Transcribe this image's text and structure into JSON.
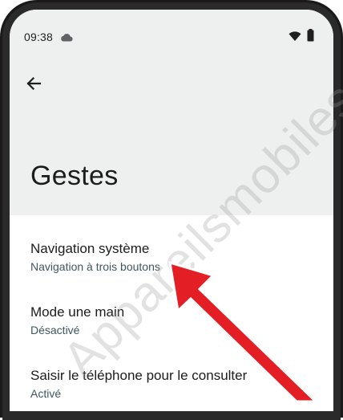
{
  "status_bar": {
    "time": "09:38",
    "icons": [
      "cloud-icon",
      "wifi-icon",
      "battery-icon"
    ]
  },
  "header": {
    "back_icon": "arrow-left-icon",
    "title": "Gestes"
  },
  "settings": [
    {
      "title": "Navigation système",
      "subtitle": "Navigation à trois boutons"
    },
    {
      "title": "Mode une main",
      "subtitle": "Désactivé"
    },
    {
      "title": "Saisir le téléphone pour le consulter",
      "subtitle": "Activé"
    }
  ],
  "watermark": "Appareilsmobiles.fr",
  "colors": {
    "header_bg": "#eeefef",
    "subtitle": "#3f5660",
    "arrow": "#e31e24"
  }
}
